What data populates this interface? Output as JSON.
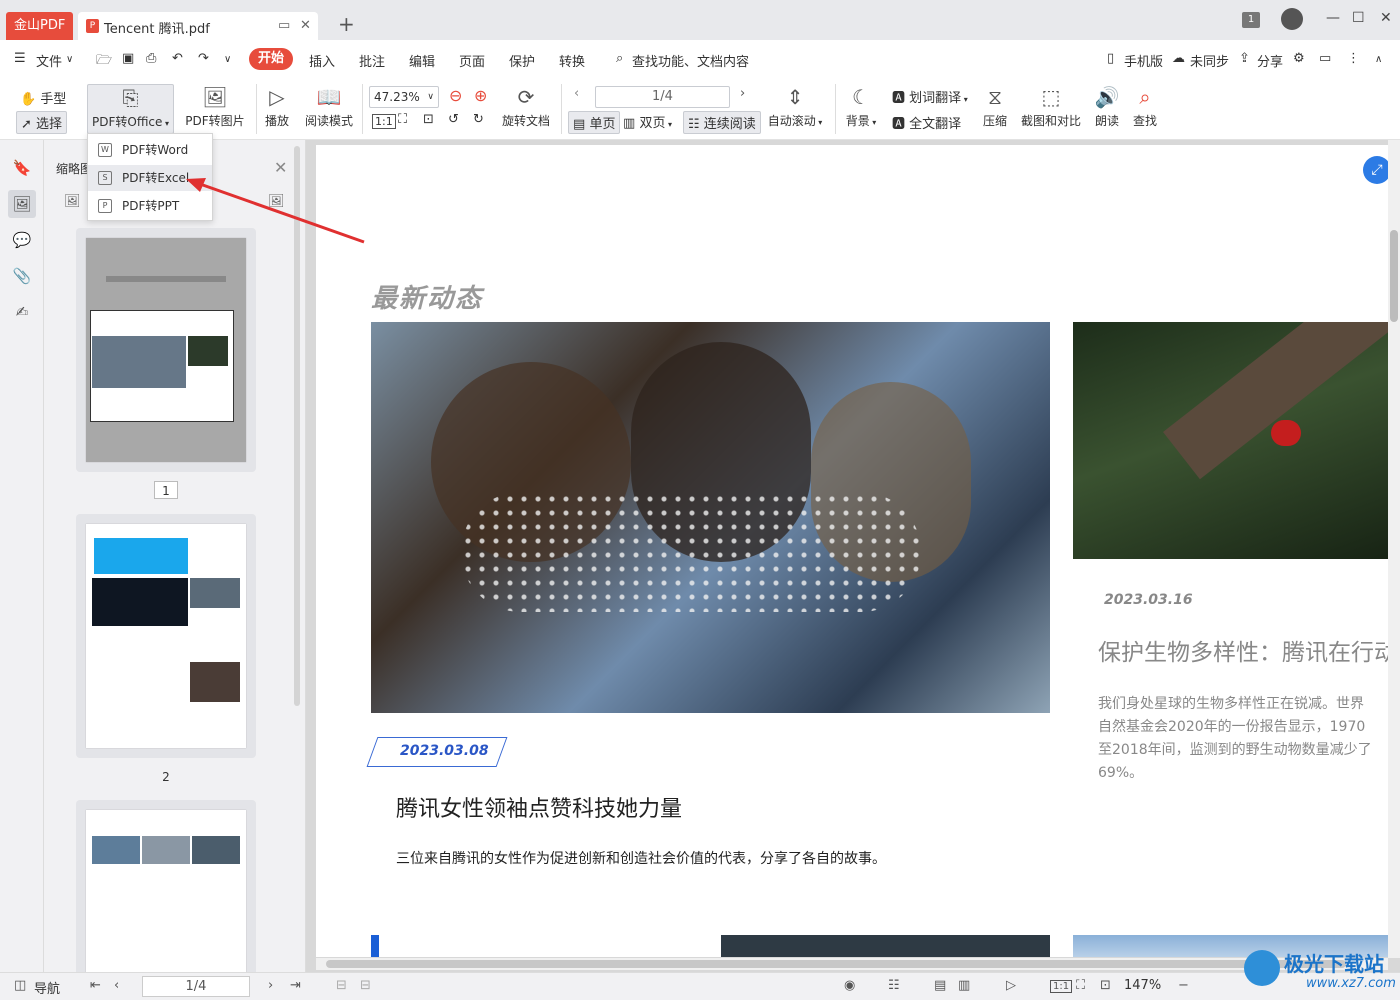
{
  "titlebar": {
    "app_tab": "金山PDF",
    "doc_tab": "Tencent 腾讯.pdf",
    "page_badge": "1"
  },
  "menubar": {
    "file": "文件",
    "start": "开始",
    "items": [
      "插入",
      "批注",
      "编辑",
      "页面",
      "保护",
      "转换"
    ],
    "search": "查找功能、文档内容",
    "right": [
      "手机版",
      "未同步",
      "分享"
    ]
  },
  "toolbar": {
    "hand": "手型",
    "select": "选择",
    "pdf_to_office": "PDF转Office",
    "pdf_to_image": "PDF转图片",
    "play": "播放",
    "read_mode": "阅读模式",
    "zoom": "47.23%",
    "rotate": "旋转文档",
    "page": "1/4",
    "single": "单页",
    "double": "双页",
    "continuous": "连续阅读",
    "autoscroll": "自动滚动",
    "background": "背景",
    "word_translate": "划词翻译",
    "full_translate": "全文翻译",
    "compress": "压缩",
    "screenshot": "截图和对比",
    "read_aloud": "朗读",
    "find": "查找"
  },
  "dropdown": {
    "items": [
      "PDF转Word",
      "PDF转Excel",
      "PDF转PPT"
    ]
  },
  "thumbnails": {
    "title": "缩略图",
    "pages": [
      "1",
      "2"
    ]
  },
  "document": {
    "section_title": "最新动态",
    "article1": {
      "date": "2023.03.08",
      "headline": "腾讯女性领袖点赞科技她力量",
      "body": "三位来自腾讯的女性作为促进创新和创造社会价值的代表，分享了各自的故事。"
    },
    "article2": {
      "date": "2023.03.16",
      "headline": "保护生物多样性：腾讯在行动",
      "body": "我们身处星球的生物多样性正在锐减。世界\n自然基金会2020年的一份报告显示，1970\n至2018年间，监测到的野生动物数量减少了\n69%。"
    }
  },
  "statusbar": {
    "nav": "导航",
    "page": "1/4",
    "zoom": "147%"
  },
  "watermark": {
    "title": "极光下载站",
    "url": "www.xz7.com"
  }
}
